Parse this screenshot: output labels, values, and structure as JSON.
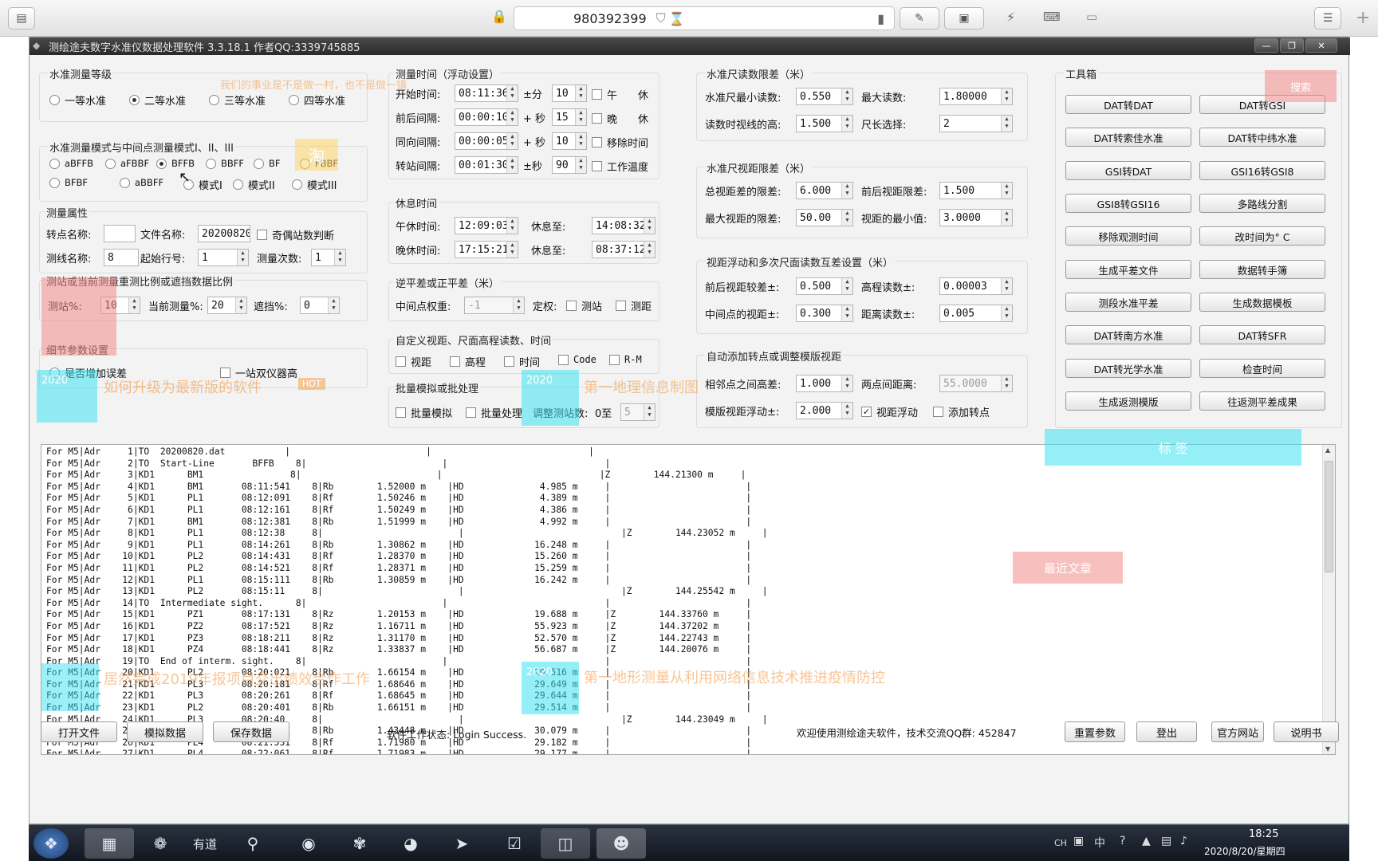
{
  "remote": {
    "session_id": "980392399"
  },
  "window": {
    "title": "测绘途夫数字水准仪数据处理软件 3.3.18.1 作者QQ:3339745885"
  },
  "level_grade": {
    "title": "水准测量等级",
    "options": [
      "一等水准",
      "二等水准",
      "三等水准",
      "四等水准"
    ]
  },
  "mode": {
    "title": "水准测量模式与中间点测量模式I、II、III",
    "row1": [
      "aBFFB",
      "aFBBF",
      "BFFB",
      "BBFF",
      "BF",
      "FBBF"
    ],
    "row2": [
      "BFBF",
      "aBBFF",
      "模式I",
      "模式II",
      "模式III"
    ]
  },
  "attr": {
    "title": "测量属性",
    "point_name_label": "转点名称:",
    "point_name": "",
    "file_label": "文件名称:",
    "file_name": "20200820",
    "odd_label": "奇偶站数判断",
    "line_label": "测线名称:",
    "line_name": "8",
    "start_row_label": "起始行号:",
    "start_row": "1",
    "count_label": "测量次数:",
    "count": "1"
  },
  "ratio": {
    "title": "测站或当前测量重测比例或遮挡数据比例",
    "station_label": "测站%:",
    "station": "10",
    "current_label": "当前测量%:",
    "current": "20",
    "block_label": "遮挡%:",
    "block": "0"
  },
  "detail": {
    "title": "细节参数设置",
    "add_error": "是否增加误差",
    "dual": "一站双仪器高"
  },
  "time": {
    "title": "测量时间（浮动设置）",
    "start_label": "开始时间:",
    "start": "08:11:36",
    "pm1": "±分",
    "pm1v": "10",
    "chk1": "午　　休",
    "fb_label": "前后间隔:",
    "fb": "00:00:10",
    "pm2": "+ 秒",
    "pm2v": "15",
    "chk2": "晚　　休",
    "same_label": "同向间隔:",
    "same": "00:00:05",
    "pm3": "+ 秒",
    "pm3v": "10",
    "chk3": "移除时间",
    "turn_label": "转站间隔:",
    "turn": "00:01:30",
    "pm4": "±秒",
    "pm4v": "90",
    "chk4": "工作温度"
  },
  "rest": {
    "title": "休息时间",
    "noon_label": "午休时间:",
    "noon": "12:09:03",
    "noon_to_label": "休息至:",
    "noon_to": "14:08:32",
    "night_label": "晚休时间:",
    "night": "17:15:21",
    "night_to_label": "休息至:",
    "night_to": "08:37:12"
  },
  "adjust": {
    "title": "逆平差或正平差（米）",
    "weight_label": "中间点权重:",
    "weight": "-1",
    "fix_label": "定权:",
    "c1": "测站",
    "c2": "测距"
  },
  "custom": {
    "title": "自定义视距、尺面高程读数、时间",
    "items": [
      "视距",
      "高程",
      "时间",
      "Code",
      "R-M"
    ]
  },
  "batch": {
    "title": "批量模拟或批处理",
    "c1": "批量模拟",
    "c2": "批量处理",
    "adj_label": "调整测站数:",
    "adj_pre": "0至",
    "adj": "5"
  },
  "staff_limit": {
    "title": "水准尺读数限差（米）",
    "min_label": "水准尺最小读数:",
    "min": "0.550",
    "max_label": "最大读数:",
    "max": "1.80000",
    "h_label": "读数时视线的高:",
    "h": "1.500",
    "len_label": "尺长选择:",
    "len": "2"
  },
  "sight_limit": {
    "title": "水准尺视距限差（米）",
    "total_label": "总视距差的限差:",
    "total": "6.000",
    "fb_label": "前后视距限差:",
    "fb": "1.500",
    "max_label": "最大视距的限差:",
    "max": "50.00",
    "min_label": "视距的最小值:",
    "min": "3.0000"
  },
  "float_set": {
    "title": "视距浮动和多次尺面读数互差设置（米）",
    "fb_label": "前后视距较差±:",
    "fb": "0.500",
    "elev_label": "高程读数±:",
    "elev": "0.00003",
    "mid_label": "中间点的视距±:",
    "mid": "0.300",
    "dist_label": "距离读数±:",
    "dist": "0.005"
  },
  "auto_add": {
    "title": "自动添加转点或调整模版视距",
    "adj_label": "相邻点之间高差:",
    "adj": "1.000",
    "two_label": "两点间距离:",
    "two": "55.0000",
    "tpl_label": "模版视距浮动±:",
    "tpl": "2.000",
    "c1": "视距浮动",
    "c2": "添加转点"
  },
  "toolbox": {
    "title": "工具箱",
    "left": [
      "DAT转DAT",
      "DAT转索佳水准",
      "GSI转DAT",
      "GSI8转GSI16",
      "移除观测时间",
      "生成平差文件",
      "测段水准平差",
      "DAT转南方水准",
      "DAT转光学水准",
      "生成返测模版"
    ],
    "right": [
      "DAT转GSI",
      "DAT转中纬水准",
      "GSI16转GSI8",
      "多路线分割",
      "改时间为° C",
      "数据转手簿",
      "生成数据模板",
      "DAT转SFR",
      "检查时间",
      "往返测平差成果"
    ]
  },
  "log_lines": [
    "For M5|Adr     1|TO  20200820.dat           |                         |                             |",
    "For M5|Adr     2|TO  Start-Line       BFFB    8|                         |                             |",
    "For M5|Adr     3|KD1      BM1                8|                         |                             |Z        144.21300 m     |",
    "For M5|Adr     4|KD1      BM1       08:11:541    8|Rb        1.52000 m    |HD              4.985 m     |                         |",
    "For M5|Adr     5|KD1      PL1       08:12:091    8|Rf        1.50246 m    |HD              4.389 m     |                         |",
    "For M5|Adr     6|KD1      PL1       08:12:161    8|Rf        1.50249 m    |HD              4.386 m     |                         |",
    "For M5|Adr     7|KD1      BM1       08:12:381    8|Rb        1.51999 m    |HD              4.992 m     |                         |",
    "For M5|Adr     8|KD1      PL1       08:12:38     8|                         |                             |Z        144.23052 m     |",
    "For M5|Adr     9|KD1      PL1       08:14:261    8|Rb        1.30862 m    |HD             16.248 m     |                         |",
    "For M5|Adr    10|KD1      PL2       08:14:431    8|Rf        1.28370 m    |HD             15.260 m     |                         |",
    "For M5|Adr    11|KD1      PL2       08:14:521    8|Rf        1.28371 m    |HD             15.259 m     |                         |",
    "For M5|Adr    12|KD1      PL1       08:15:111    8|Rb        1.30859 m    |HD             16.242 m     |                         |",
    "For M5|Adr    13|KD1      PL2       08:15:11     8|                         |                             |Z        144.25542 m     |",
    "For M5|Adr    14|TO  Intermediate sight.      8|                         |                             |                         |",
    "For M5|Adr    15|KD1      PZ1       08:17:131    8|Rz        1.20153 m    |HD             19.688 m     |Z        144.33760 m     |",
    "For M5|Adr    16|KD1      PZ2       08:17:521    8|Rz        1.16711 m    |HD             55.923 m     |Z        144.37202 m     |",
    "For M5|Adr    17|KD1      PZ3       08:18:211    8|Rz        1.31170 m    |HD             52.570 m     |Z        144.22743 m     |",
    "For M5|Adr    18|KD1      PZ4       08:18:441    8|Rz        1.33837 m    |HD             56.687 m     |Z        144.20076 m     |",
    "For M5|Adr    19|TO  End of interm. sight.    8|                         |                             |                         |",
    "For M5|Adr    20|KD1      PL2       08:20:021    8|Rb        1.66154 m    |HD             29.516 m     |                         |",
    "For M5|Adr    21|KD1      PL3       08:20:181    8|Rf        1.68646 m    |HD             29.649 m     |                         |",
    "For M5|Adr    22|KD1      PL3       08:20:261    8|Rf        1.68645 m    |HD             29.644 m     |                         |",
    "For M5|Adr    23|KD1      PL2       08:20:401    8|Rb        1.66151 m    |HD             29.514 m     |                         |",
    "For M5|Adr    24|KD1      PL3       08:20:40     8|                         |                             |Z        144.23049 m     |",
    "For M5|Adr    25|KD1      PL3       08:21:301    8|Rb        1.43448 m    |HD             30.079 m     |                         |",
    "For M5|Adr    26|KD1      PL4       08:21:531    8|Rf        1.71980 m    |HD             29.182 m     |                         |",
    "For M5|Adr    27|KD1      PL4       08:22:061    8|Rf        1.71983 m    |HD             29.177 m     |                         |"
  ],
  "bottom": {
    "open": "打开文件",
    "sim": "模拟数据",
    "save": "保存数据",
    "status": "软件工作状态: Login Success.",
    "welcome": "欢迎使用测绘途夫软件，技术交流QQ群: 452847",
    "reset": "重置参数",
    "logout": "登出",
    "site": "官方网站",
    "manual": "说明书"
  },
  "overlays": {
    "o1": "我们的事业是不是做一村，也不是做一镇",
    "o2": "淘",
    "o3": "如何升级为最新版的软件",
    "o4": "HOT",
    "o5": "2020",
    "o6": "第一地理信息制图",
    "o7": "最近文章",
    "o8": "第一地形测量从利用网络信息技术推进疫情防控",
    "o9": "居然完成2019年报项目交出绩效合作工作",
    "o10": "搜索",
    "o11": "标 签"
  },
  "taskbar": {
    "ime": "CH",
    "ime2": "中",
    "time": "18:25",
    "date": "2020/8/20/星期四",
    "app_label": "有道"
  },
  "colors": {
    "titlebar": "#2f2f2f",
    "overlay_orange": "#f5a050",
    "overlay_cyan": "#3ce2f0",
    "overlay_red": "#f28a8a"
  }
}
